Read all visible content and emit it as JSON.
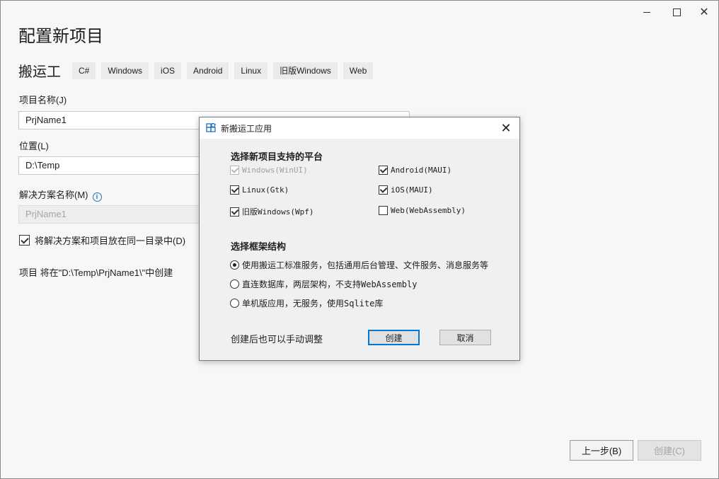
{
  "window": {
    "minimize_glyph": "",
    "close_glyph": "✕"
  },
  "page": {
    "title": "配置新项目",
    "template_name": "搬运工",
    "tags": [
      "C#",
      "Windows",
      "iOS",
      "Android",
      "Linux",
      "旧版Windows",
      "Web"
    ]
  },
  "form": {
    "project_name_label": "项目名称(J)",
    "project_name_value": "PrjName1",
    "location_label": "位置(L)",
    "location_value": "D:\\Temp",
    "solution_name_label": "解决方案名称(M)",
    "solution_name_value": "PrjName1",
    "same_dir_label": "将解决方案和项目放在同一目录中(D)",
    "same_dir_checked": true,
    "create_note": "项目 将在\"D:\\Temp\\PrjName1\\\"中创建"
  },
  "buttons": {
    "back": "上一步(B)",
    "create": "创建(C)"
  },
  "dialog": {
    "title": "新搬运工应用",
    "close_glyph": "✕",
    "platform_section": "选择新项目支持的平台",
    "platforms": [
      {
        "label": "Windows(WinUI)",
        "checked": true,
        "disabled": true
      },
      {
        "label": "Android(MAUI)",
        "checked": true,
        "disabled": false
      },
      {
        "label": "Linux(Gtk)",
        "checked": true,
        "disabled": false
      },
      {
        "label": "iOS(MAUI)",
        "checked": true,
        "disabled": false
      },
      {
        "label": "旧版Windows(Wpf)",
        "checked": true,
        "disabled": false
      },
      {
        "label": "Web(WebAssembly)",
        "checked": false,
        "disabled": false
      }
    ],
    "framework_section": "选择框架结构",
    "frameworks": [
      {
        "label": "使用搬运工标准服务，包括通用后台管理、文件服务、消息服务等",
        "selected": true
      },
      {
        "label": "直连数据库，两层架构，不支持WebAssembly",
        "selected": false
      },
      {
        "label": "单机版应用，无服务，使用Sqlite库",
        "selected": false
      }
    ],
    "hint": "创建后也可以手动调整",
    "ok_label": "创建",
    "cancel_label": "取消"
  },
  "colors": {
    "accent": "#0078d7",
    "info": "#1f6fbf",
    "tag_bg": "#ebebec",
    "disabled_text": "#a6a6a6"
  }
}
